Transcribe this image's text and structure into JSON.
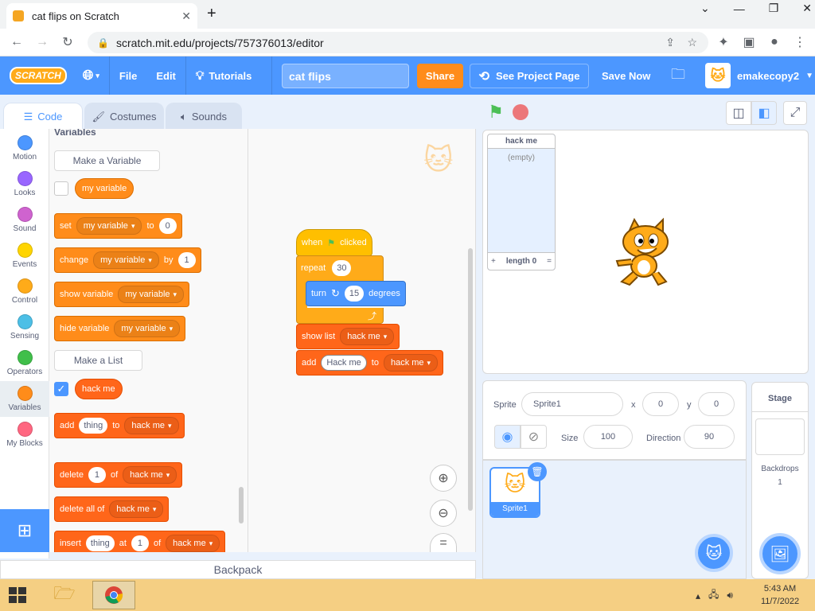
{
  "browser": {
    "tab_title": "cat flips on Scratch",
    "url": "scratch.mit.edu/projects/757376013/editor"
  },
  "menubar": {
    "logo": "SCRATCH",
    "file": "File",
    "edit": "Edit",
    "tutorials": "Tutorials",
    "project_title": "cat flips",
    "share": "Share",
    "see_project_page": "See Project Page",
    "save_now": "Save Now",
    "username": "emakecopy2"
  },
  "editor_tabs": {
    "code": "Code",
    "costumes": "Costumes",
    "sounds": "Sounds"
  },
  "categories": [
    {
      "label": "Motion",
      "color": "#4c97ff"
    },
    {
      "label": "Looks",
      "color": "#9966ff"
    },
    {
      "label": "Sound",
      "color": "#cf63cf"
    },
    {
      "label": "Events",
      "color": "#ffd500"
    },
    {
      "label": "Control",
      "color": "#ffab19"
    },
    {
      "label": "Sensing",
      "color": "#4cbfe6"
    },
    {
      "label": "Operators",
      "color": "#40bf4a"
    },
    {
      "label": "Variables",
      "color": "#ff8c1a"
    },
    {
      "label": "My Blocks",
      "color": "#ff6680"
    }
  ],
  "palette": {
    "section_title": "Variables",
    "make_variable": "Make a Variable",
    "variable_name": "my variable",
    "set": {
      "op": "set",
      "var": "my variable",
      "to": "to",
      "value": "0"
    },
    "change": {
      "op": "change",
      "var": "my variable",
      "by": "by",
      "value": "1"
    },
    "show_variable": {
      "op": "show variable",
      "var": "my variable"
    },
    "hide_variable": {
      "op": "hide variable",
      "var": "my variable"
    },
    "make_list": "Make a List",
    "list_name": "hack me",
    "add": {
      "op": "add",
      "item": "thing",
      "to": "to",
      "list": "hack me"
    },
    "delete": {
      "op": "delete",
      "index": "1",
      "of": "of",
      "list": "hack me"
    },
    "delete_all": {
      "op": "delete all of",
      "list": "hack me"
    },
    "insert": {
      "op": "insert",
      "item": "thing",
      "at": "at",
      "index": "1",
      "of": "of",
      "list": "hack me"
    }
  },
  "script": {
    "when_flag": {
      "when": "when",
      "clicked": "clicked"
    },
    "repeat": {
      "label": "repeat",
      "count": "30"
    },
    "turn": {
      "label": "turn",
      "degrees_value": "15",
      "degrees": "degrees"
    },
    "show_list": {
      "label": "show list",
      "list": "hack me"
    },
    "add": {
      "label": "add",
      "item": "Hack me",
      "to": "to",
      "list": "hack me"
    }
  },
  "backpack": "Backpack",
  "list_monitor": {
    "title": "hack me",
    "empty": "(empty)",
    "add": "+",
    "length": "length 0",
    "equals": "="
  },
  "sprite_info": {
    "sprite_label": "Sprite",
    "sprite_name": "Sprite1",
    "x_label": "x",
    "x_value": "0",
    "y_label": "y",
    "y_value": "0",
    "size_label": "Size",
    "size_value": "100",
    "direction_label": "Direction",
    "direction_value": "90"
  },
  "sprite_list": {
    "sprite1": "Sprite1"
  },
  "stage_panel": {
    "title": "Stage",
    "backdrops_label": "Backdrops",
    "backdrops_count": "1"
  },
  "taskbar": {
    "time": "5:43 AM",
    "date": "11/7/2022"
  }
}
